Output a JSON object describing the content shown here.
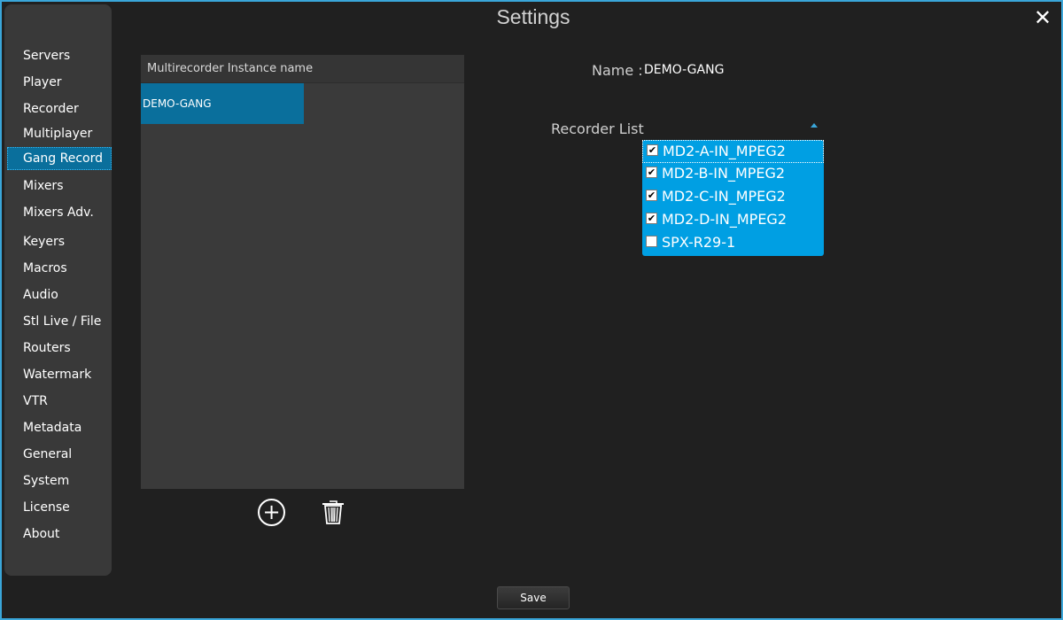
{
  "window": {
    "title": "Settings",
    "close_icon": "close-icon"
  },
  "sidebar": {
    "items": [
      {
        "label": "Servers"
      },
      {
        "label": "Player"
      },
      {
        "label": "Recorder"
      },
      {
        "label": "Multiplayer"
      },
      {
        "label": "Gang Record",
        "active": true
      },
      {
        "label": "Mixers"
      },
      {
        "label": "Mixers Adv."
      },
      {
        "label": "Keyers"
      },
      {
        "label": "Macros"
      },
      {
        "label": "Audio"
      },
      {
        "label": "Stl Live / File"
      },
      {
        "label": "Routers"
      },
      {
        "label": "Watermark"
      },
      {
        "label": "VTR"
      },
      {
        "label": "Metadata"
      },
      {
        "label": "General"
      },
      {
        "label": "System"
      },
      {
        "label": "License"
      },
      {
        "label": "About"
      }
    ]
  },
  "instances": {
    "header": "Multirecorder Instance name",
    "rows": [
      {
        "name": "DEMO-GANG",
        "selected": true
      }
    ],
    "add_icon": "plus-circle-icon",
    "delete_icon": "trash-icon"
  },
  "details": {
    "name_label": "Name :",
    "name_value": "DEMO-GANG",
    "recorder_list_label": "Recorder List",
    "recorders": [
      {
        "label": "MD2-A-IN_MPEG2",
        "checked": true,
        "check_glyph": "✔"
      },
      {
        "label": "MD2-B-IN_MPEG2",
        "checked": true,
        "check_glyph": "✔"
      },
      {
        "label": "MD2-C-IN_MPEG2",
        "checked": true,
        "check_glyph": "✔"
      },
      {
        "label": "MD2-D-IN_MPEG2",
        "checked": true,
        "check_glyph": "✔"
      },
      {
        "label": "SPX-R29-1",
        "checked": false,
        "check_glyph": ""
      }
    ]
  },
  "footer": {
    "save_label": "Save"
  },
  "colors": {
    "accent": "#009fe3",
    "selected": "#0a6f9c",
    "background": "#202020",
    "border": "#3aa6d9"
  }
}
